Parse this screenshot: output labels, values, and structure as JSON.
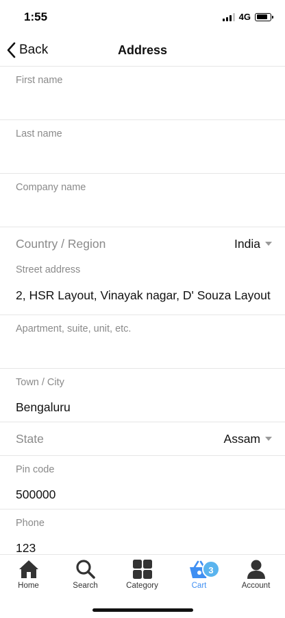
{
  "status_bar": {
    "time": "1:55",
    "network": "4G"
  },
  "nav": {
    "back_label": "Back",
    "title": "Address"
  },
  "form": {
    "first_name": {
      "label": "First name",
      "value": ""
    },
    "last_name": {
      "label": "Last name",
      "value": ""
    },
    "company_name": {
      "label": "Company name",
      "value": ""
    },
    "country": {
      "label": "Country / Region",
      "value": "India"
    },
    "street_address": {
      "label": "Street address",
      "value": "2, HSR Layout, Vinayak nagar, D' Souza Layout"
    },
    "apartment": {
      "label": "Apartment, suite, unit, etc.",
      "value": ""
    },
    "town_city": {
      "label": "Town / City",
      "value": "Bengaluru"
    },
    "state": {
      "label": "State",
      "value": "Assam"
    },
    "pin_code": {
      "label": "Pin code",
      "value": "500000"
    },
    "phone": {
      "label": "Phone",
      "value": "123"
    }
  },
  "tab_bar": {
    "items": [
      {
        "label": "Home",
        "icon": "home-icon"
      },
      {
        "label": "Search",
        "icon": "search-icon"
      },
      {
        "label": "Category",
        "icon": "grid-icon"
      },
      {
        "label": "Cart",
        "icon": "basket-icon",
        "badge": "3",
        "active": true
      },
      {
        "label": "Account",
        "icon": "user-icon"
      }
    ],
    "active_color": "#3f8ff2",
    "badge_color": "#5ab4ee"
  }
}
